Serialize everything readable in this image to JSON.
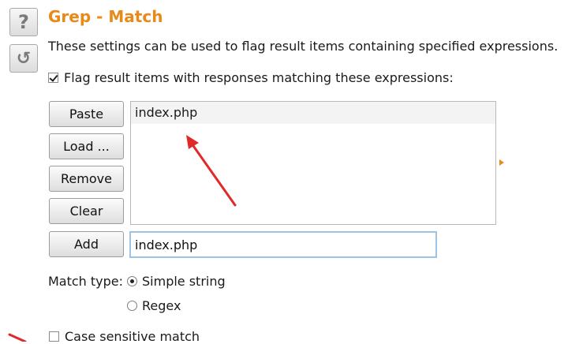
{
  "header": {
    "title": "Grep - Match",
    "description": "These settings can be used to flag result items containing specified expressions."
  },
  "side_buttons": [
    {
      "icon": "help-icon",
      "glyph": "?"
    },
    {
      "icon": "reset-icon",
      "glyph": "↺"
    }
  ],
  "flag": {
    "checked": true,
    "label": "Flag result items with responses matching these expressions:"
  },
  "buttons": {
    "paste": "Paste",
    "load": "Load ...",
    "remove": "Remove",
    "clear": "Clear",
    "add": "Add"
  },
  "expressions": [
    "index.php"
  ],
  "add_input": {
    "value": "index.php"
  },
  "match_type": {
    "label": "Match type:",
    "options": [
      "Simple string",
      "Regex"
    ],
    "selected": "Simple string"
  },
  "case_sensitive": {
    "checked": false,
    "label": "Case sensitive match"
  },
  "colors": {
    "accent": "#e8891a",
    "annotation_arrow": "#e02a2a"
  }
}
